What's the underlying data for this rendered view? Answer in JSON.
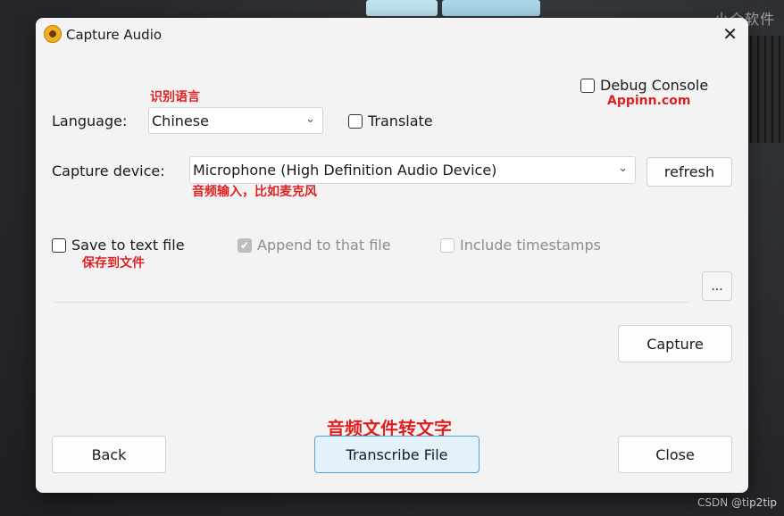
{
  "watermark": {
    "top": "小众软件",
    "bottom": "CSDN @tip2tip"
  },
  "window": {
    "title": "Capture Audio"
  },
  "language": {
    "label": "Language:",
    "value": "Chinese",
    "annotation": "识别语言"
  },
  "translate": {
    "label": "Translate",
    "checked": false
  },
  "debug": {
    "label": "Debug Console",
    "checked": false,
    "annotation": "Appinn.com"
  },
  "capture_device": {
    "label": "Capture device:",
    "value": "Microphone (High Definition Audio Device)",
    "annotation": "音频输入，比如麦克风",
    "refresh_label": "refresh"
  },
  "save": {
    "label": "Save to text file",
    "checked": false,
    "annotation": "保存到文件",
    "append_label": "Append to that file",
    "append_checked": true,
    "timestamps_label": "Include timestamps",
    "timestamps_checked": false,
    "browse_label": "..."
  },
  "buttons": {
    "capture": "Capture",
    "back": "Back",
    "transcribe": "Transcribe File",
    "transcribe_annotation": "音频文件转文字",
    "close": "Close"
  },
  "colors": {
    "annotation": "#e01e1e",
    "primary_border": "#5aa0d8",
    "primary_bg": "#e3f1fb"
  }
}
